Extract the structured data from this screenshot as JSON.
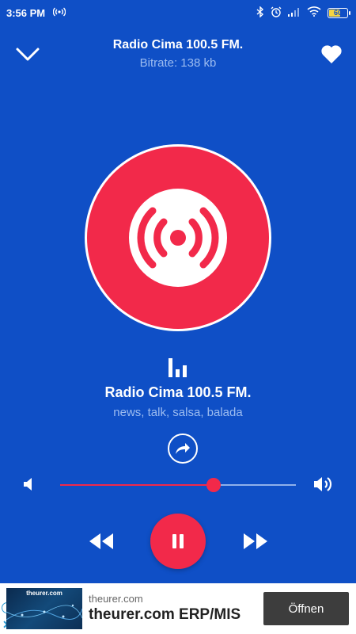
{
  "status_bar": {
    "time": "3:56 PM",
    "battery_level": "60",
    "icons": [
      "radio-broadcast-icon",
      "bluetooth-icon",
      "alarm-icon",
      "signal-icon",
      "wifi-icon",
      "battery-icon"
    ]
  },
  "header": {
    "title": "Radio Cima 100.5 FM.",
    "bitrate": "Bitrate: 138 kb"
  },
  "station": {
    "name": "Radio Cima 100.5 FM.",
    "tags": "news, talk, salsa, balada"
  },
  "volume": {
    "level": 0.65
  },
  "colors": {
    "background": "#0f4fc6",
    "accent": "#f2294a",
    "muted_text": "#9cbcf0"
  },
  "ad": {
    "thumbnail_label": "theurer.com",
    "domain": "theurer.com",
    "title": "theurer.com ERP/MIS",
    "cta": "Öffnen"
  }
}
